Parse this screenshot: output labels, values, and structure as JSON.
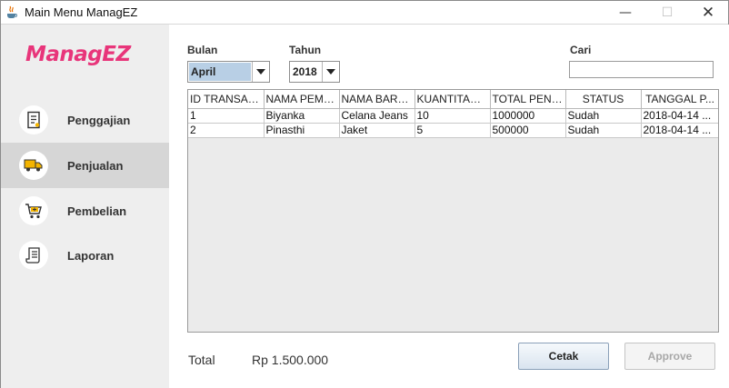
{
  "window": {
    "title": "Main Menu ManagEZ",
    "minimize_glyph": "—",
    "maximize_glyph": "☐",
    "close_glyph": "✕"
  },
  "sidebar": {
    "logo": "ManagEZ",
    "items": [
      {
        "label": "Penggajian",
        "icon": "payroll-document-icon",
        "active": false
      },
      {
        "label": "Penjualan",
        "icon": "delivery-truck-icon",
        "active": true
      },
      {
        "label": "Pembelian",
        "icon": "shopping-cart-icon",
        "active": false
      },
      {
        "label": "Laporan",
        "icon": "report-receipt-icon",
        "active": false
      }
    ]
  },
  "filters": {
    "month_label": "Bulan",
    "month_value": "April",
    "year_label": "Tahun",
    "year_value": "2018",
    "search_label": "Cari",
    "search_value": ""
  },
  "table": {
    "columns": [
      "ID TRANSAKSI",
      "NAMA PEMB...",
      "NAMA BARA...",
      "KUANTITAS ...",
      "TOTAL PENJ...",
      "STATUS",
      "TANGGAL P..."
    ],
    "rows": [
      [
        "1",
        "Biyanka",
        "Celana Jeans",
        "10",
        "1000000",
        "Sudah",
        "2018-04-14 ..."
      ],
      [
        "2",
        "Pinasthi",
        "Jaket",
        "5",
        "500000",
        "Sudah",
        "2018-04-14 ..."
      ]
    ]
  },
  "footer": {
    "total_label": "Total",
    "total_value": "Rp 1.500.000",
    "print_button": "Cetak",
    "approve_button": "Approve"
  },
  "colors": {
    "brand": "#e8357a",
    "selected_month_bg": "#b8cfe5",
    "sidebar_bg": "#eeeeee",
    "sidebar_active": "#d6d6d6"
  }
}
